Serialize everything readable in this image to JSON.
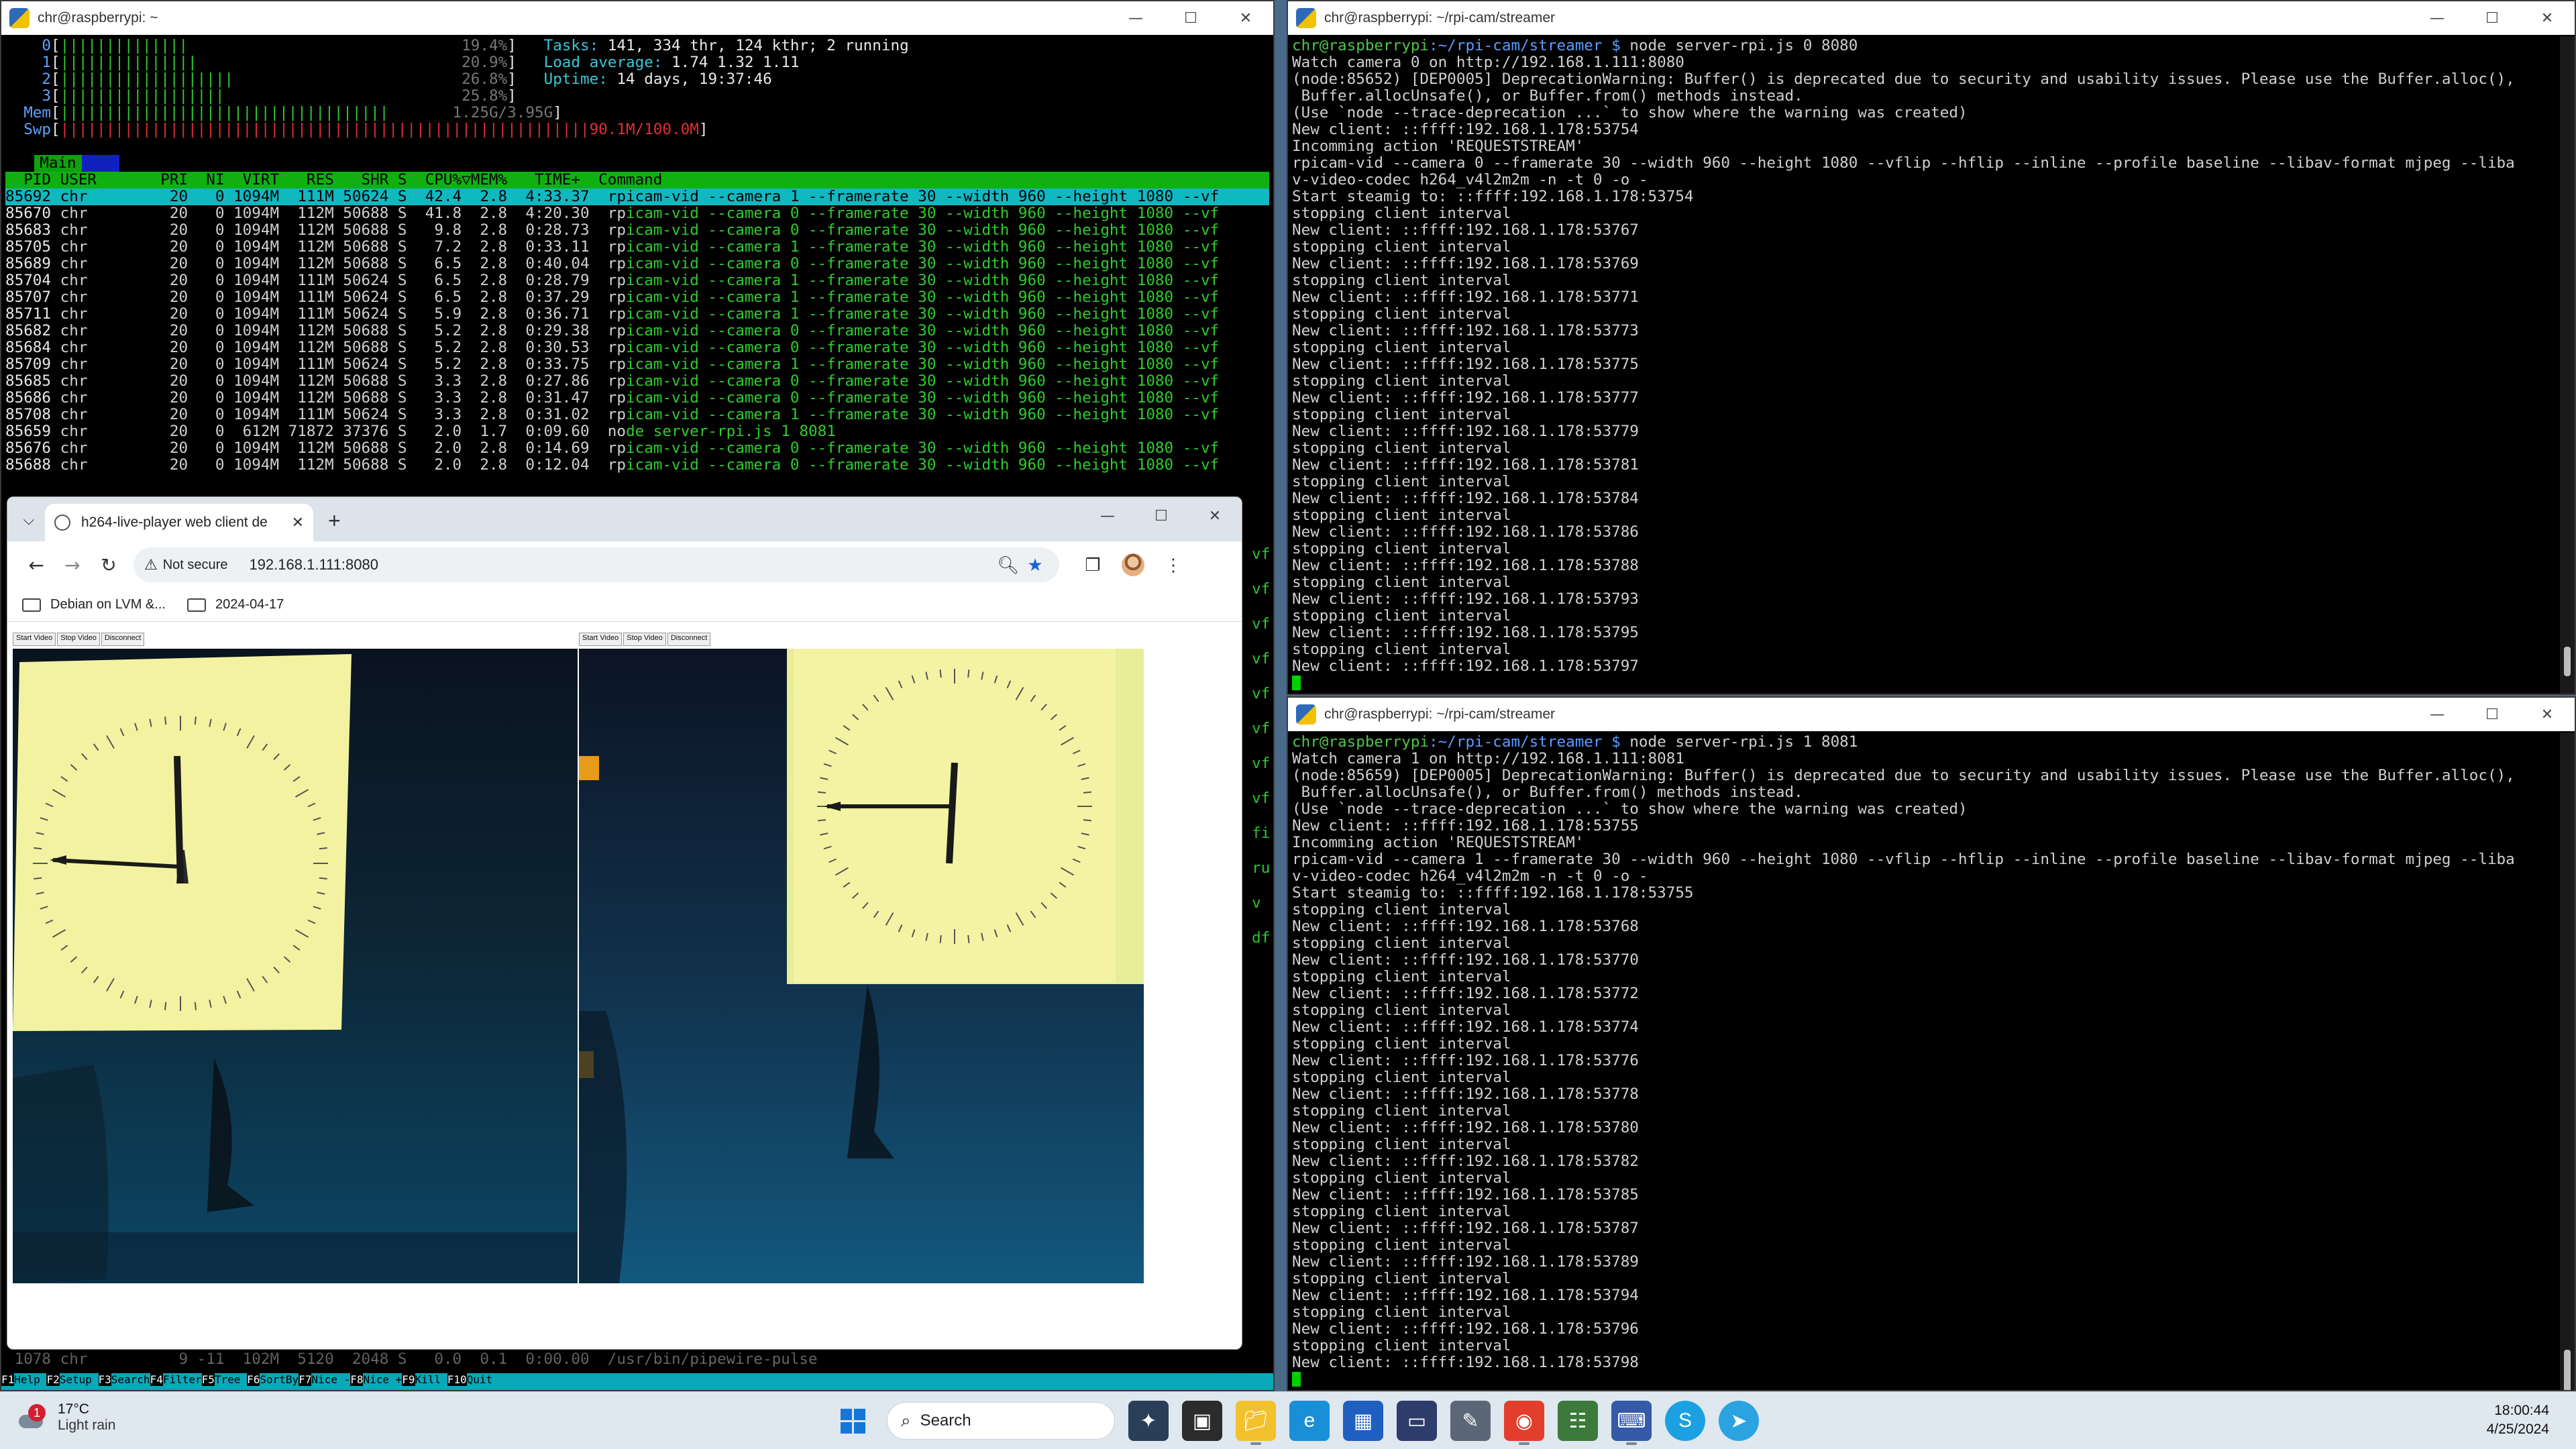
{
  "htop_window": {
    "title": "chr@raspberrypi: ~",
    "cpu_meters": [
      {
        "id": "0",
        "bar": "||||||||||||||",
        "pct": "19.4%"
      },
      {
        "id": "1",
        "bar": "|||||||||||||||",
        "pct": "20.9%"
      },
      {
        "id": "2",
        "bar": "|||||||||||||||||||",
        "pct": "26.8%"
      },
      {
        "id": "3",
        "bar": "||||||||||||||||||",
        "pct": "25.8%"
      }
    ],
    "mem": {
      "label": "Mem",
      "bar": "||||||||||||||||||||||||||||||||||||",
      "value": "1.25G/3.95G"
    },
    "swp": {
      "label": "Swp",
      "value": "90.1M/100.0M"
    },
    "tasks": {
      "label": "Tasks:",
      "value": "141, 334 thr, 124 kthr; 2 running"
    },
    "load": {
      "label": "Load average:",
      "value": "1.74 1.32 1.11"
    },
    "uptime": {
      "label": "Uptime:",
      "value": "14 days, 19:37:46"
    },
    "tab_main": "Main",
    "tab_io": "I/O",
    "header": "  PID USER       PRI  NI  VIRT   RES   SHR S  CPU%▽MEM%   TIME+  Command",
    "rows": [
      "85692 chr         20   0 1094M  111M 50624 S  42.4  2.8  4:33.37  rpicam-vid --camera 1 --framerate 30 --width 960 --height 1080 --vf",
      "85670 chr         20   0 1094M  112M 50688 S  41.8  2.8  4:20.30  rpicam-vid --camera 0 --framerate 30 --width 960 --height 1080 --vf",
      "85683 chr         20   0 1094M  112M 50688 S   9.8  2.8  0:28.73  rpicam-vid --camera 0 --framerate 30 --width 960 --height 1080 --vf",
      "85705 chr         20   0 1094M  112M 50688 S   7.2  2.8  0:33.11  rpicam-vid --camera 1 --framerate 30 --width 960 --height 1080 --vf",
      "85689 chr         20   0 1094M  112M 50688 S   6.5  2.8  0:40.04  rpicam-vid --camera 0 --framerate 30 --width 960 --height 1080 --vf",
      "85704 chr         20   0 1094M  111M 50624 S   6.5  2.8  0:28.79  rpicam-vid --camera 1 --framerate 30 --width 960 --height 1080 --vf",
      "85707 chr         20   0 1094M  111M 50624 S   6.5  2.8  0:37.29  rpicam-vid --camera 1 --framerate 30 --width 960 --height 1080 --vf",
      "85711 chr         20   0 1094M  111M 50624 S   5.9  2.8  0:36.71  rpicam-vid --camera 1 --framerate 30 --width 960 --height 1080 --vf",
      "85682 chr         20   0 1094M  112M 50688 S   5.2  2.8  0:29.38  rpicam-vid --camera 0 --framerate 30 --width 960 --height 1080 --vf",
      "85684 chr         20   0 1094M  112M 50688 S   5.2  2.8  0:30.53  rpicam-vid --camera 0 --framerate 30 --width 960 --height 1080 --vf",
      "85709 chr         20   0 1094M  111M 50624 S   5.2  2.8  0:33.75  rpicam-vid --camera 1 --framerate 30 --width 960 --height 1080 --vf",
      "85685 chr         20   0 1094M  112M 50688 S   3.3  2.8  0:27.86  rpicam-vid --camera 0 --framerate 30 --width 960 --height 1080 --vf",
      "85686 chr         20   0 1094M  112M 50688 S   3.3  2.8  0:31.47  rpicam-vid --camera 0 --framerate 30 --width 960 --height 1080 --vf",
      "85708 chr         20   0 1094M  111M 50624 S   3.3  2.8  0:31.02  rpicam-vid --camera 1 --framerate 30 --width 960 --height 1080 --vf",
      "85659 chr         20   0  612M 71872 37376 S   2.0  1.7  0:09.60  node server-rpi.js 1 8081",
      "85676 chr         20   0 1094M  112M 50688 S   2.0  2.8  0:14.69  rpicam-vid --camera 0 --framerate 30 --width 960 --height 1080 --vf",
      "85688 chr         20   0 1094M  112M 50688 S   2.0  2.8  0:12.04  rpicam-vid --camera 0 --framerate 30 --width 960 --height 1080 --vf"
    ],
    "bottom_row": " 1078 chr          9 -11  102M  5120  2048 S   0.0  0.1  0:00.00  /usr/bin/pipewire-pulse",
    "fkeys": [
      {
        "k": "F1",
        "l": "Help  "
      },
      {
        "k": "F2",
        "l": "Setup "
      },
      {
        "k": "F3",
        "l": "Search"
      },
      {
        "k": "F4",
        "l": "Filter"
      },
      {
        "k": "F5",
        "l": "Tree  "
      },
      {
        "k": "F6",
        "l": "SortBy"
      },
      {
        "k": "F7",
        "l": "Nice -"
      },
      {
        "k": "F8",
        "l": "Nice +"
      },
      {
        "k": "F9",
        "l": "Kill  "
      },
      {
        "k": "F10",
        "l": "Quit"
      }
    ],
    "edge_fragments": [
      "vf",
      "vf",
      "vf",
      "vf",
      "vf",
      "vf",
      "vf",
      "vf",
      "fi",
      "ru",
      "v",
      "df"
    ]
  },
  "terminal_top": {
    "title": "chr@raspberrypi: ~/rpi-cam/streamer",
    "prompt_user": "chr@raspberrypi",
    "prompt_path": ":~/rpi-cam/streamer $",
    "command": " node server-rpi.js 0 8080",
    "lines": [
      "Watch camera 0 on http://192.168.1.111:8080",
      "(node:85652) [DEP0005] DeprecationWarning: Buffer() is deprecated due to security and usability issues. Please use the Buffer.alloc(),",
      " Buffer.allocUnsafe(), or Buffer.from() methods instead.",
      "(Use `node --trace-deprecation ...` to show where the warning was created)",
      "New client: ::ffff:192.168.1.178:53754",
      "Incomming action 'REQUESTSTREAM'",
      "rpicam-vid --camera 0 --framerate 30 --width 960 --height 1080 --vflip --hflip --inline --profile baseline --libav-format mjpeg --liba",
      "v-video-codec h264_v4l2m2m -n -t 0 -o -",
      "Start steamig to: ::ffff:192.168.1.178:53754",
      "stopping client interval",
      "New client: ::ffff:192.168.1.178:53767",
      "stopping client interval",
      "New client: ::ffff:192.168.1.178:53769",
      "stopping client interval",
      "New client: ::ffff:192.168.1.178:53771",
      "stopping client interval",
      "New client: ::ffff:192.168.1.178:53773",
      "stopping client interval",
      "New client: ::ffff:192.168.1.178:53775",
      "stopping client interval",
      "New client: ::ffff:192.168.1.178:53777",
      "stopping client interval",
      "New client: ::ffff:192.168.1.178:53779",
      "stopping client interval",
      "New client: ::ffff:192.168.1.178:53781",
      "stopping client interval",
      "New client: ::ffff:192.168.1.178:53784",
      "stopping client interval",
      "New client: ::ffff:192.168.1.178:53786",
      "stopping client interval",
      "New client: ::ffff:192.168.1.178:53788",
      "stopping client interval",
      "New client: ::ffff:192.168.1.178:53793",
      "stopping client interval",
      "New client: ::ffff:192.168.1.178:53795",
      "stopping client interval",
      "New client: ::ffff:192.168.1.178:53797"
    ]
  },
  "terminal_bottom": {
    "title": "chr@raspberrypi: ~/rpi-cam/streamer",
    "prompt_user": "chr@raspberrypi",
    "prompt_path": ":~/rpi-cam/streamer $",
    "command": " node server-rpi.js 1 8081",
    "lines": [
      "Watch camera 1 on http://192.168.1.111:8081",
      "(node:85659) [DEP0005] DeprecationWarning: Buffer() is deprecated due to security and usability issues. Please use the Buffer.alloc(),",
      " Buffer.allocUnsafe(), or Buffer.from() methods instead.",
      "(Use `node --trace-deprecation ...` to show where the warning was created)",
      "New client: ::ffff:192.168.1.178:53755",
      "Incomming action 'REQUESTSTREAM'",
      "rpicam-vid --camera 1 --framerate 30 --width 960 --height 1080 --vflip --hflip --inline --profile baseline --libav-format mjpeg --liba",
      "v-video-codec h264_v4l2m2m -n -t 0 -o -",
      "Start steamig to: ::ffff:192.168.1.178:53755",
      "stopping client interval",
      "New client: ::ffff:192.168.1.178:53768",
      "stopping client interval",
      "New client: ::ffff:192.168.1.178:53770",
      "stopping client interval",
      "New client: ::ffff:192.168.1.178:53772",
      "stopping client interval",
      "New client: ::ffff:192.168.1.178:53774",
      "stopping client interval",
      "New client: ::ffff:192.168.1.178:53776",
      "stopping client interval",
      "New client: ::ffff:192.168.1.178:53778",
      "stopping client interval",
      "New client: ::ffff:192.168.1.178:53780",
      "stopping client interval",
      "New client: ::ffff:192.168.1.178:53782",
      "stopping client interval",
      "New client: ::ffff:192.168.1.178:53785",
      "stopping client interval",
      "New client: ::ffff:192.168.1.178:53787",
      "stopping client interval",
      "New client: ::ffff:192.168.1.178:53789",
      "stopping client interval",
      "New client: ::ffff:192.168.1.178:53794",
      "stopping client interval",
      "New client: ::ffff:192.168.1.178:53796",
      "stopping client interval",
      "New client: ::ffff:192.168.1.178:53798"
    ]
  },
  "browser": {
    "tab_title": "h264-live-player web client de",
    "security": "Not secure",
    "url": "192.168.1.111:8080",
    "bookmarks": [
      "Debian on LVM &...",
      "2024-04-17"
    ],
    "player_buttons": [
      "Start Video",
      "Stop Video",
      "Disconnect"
    ]
  },
  "taskbar": {
    "weather_badge": "1",
    "temperature": "17°C",
    "condition": "Light rain",
    "search_label": "Search",
    "time": "18:00:44",
    "date": "4/25/2024"
  },
  "window_controls": {
    "minimize": "—",
    "maximize": "☐",
    "close": "✕"
  }
}
